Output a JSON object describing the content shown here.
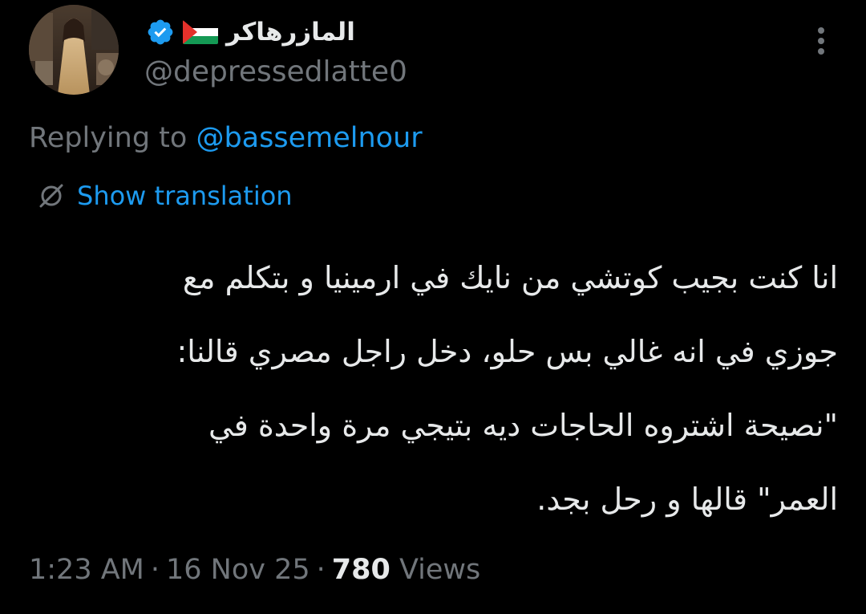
{
  "author": {
    "display_name": "المازرهاكر",
    "handle": "@depressedlatte0",
    "verified": true,
    "flag_icon": "palestine-flag-icon",
    "colors": {
      "verified_blue": "#1d9bf0",
      "flag_black": "#000000",
      "flag_white": "#ffffff",
      "flag_green": "#149954",
      "flag_red": "#e4312b"
    }
  },
  "reply": {
    "prefix": "Replying to ",
    "target": "@bassemelnour"
  },
  "translation": {
    "label": "Show translation",
    "icon": "globe-translate-icon"
  },
  "body": {
    "lines": [
      "انا كنت بجيب كوتشي من نايك في ارمينيا و بتكلم مع",
      "جوزي في انه غالي بس حلو، دخل راجل مصري قالنا:",
      "\"نصيحة اشتروه الحاجات ديه بتيجي مرة واحدة في",
      "العمر\" قالها و رحل بجد."
    ]
  },
  "meta": {
    "time": "1:23 AM",
    "separator": "·",
    "date": "16 Nov 25",
    "views_count": "780",
    "views_label": "Views"
  },
  "theme": {
    "background": "#000000",
    "text_primary": "#e7e9ea",
    "text_secondary": "#71767b",
    "accent": "#1d9bf0"
  }
}
